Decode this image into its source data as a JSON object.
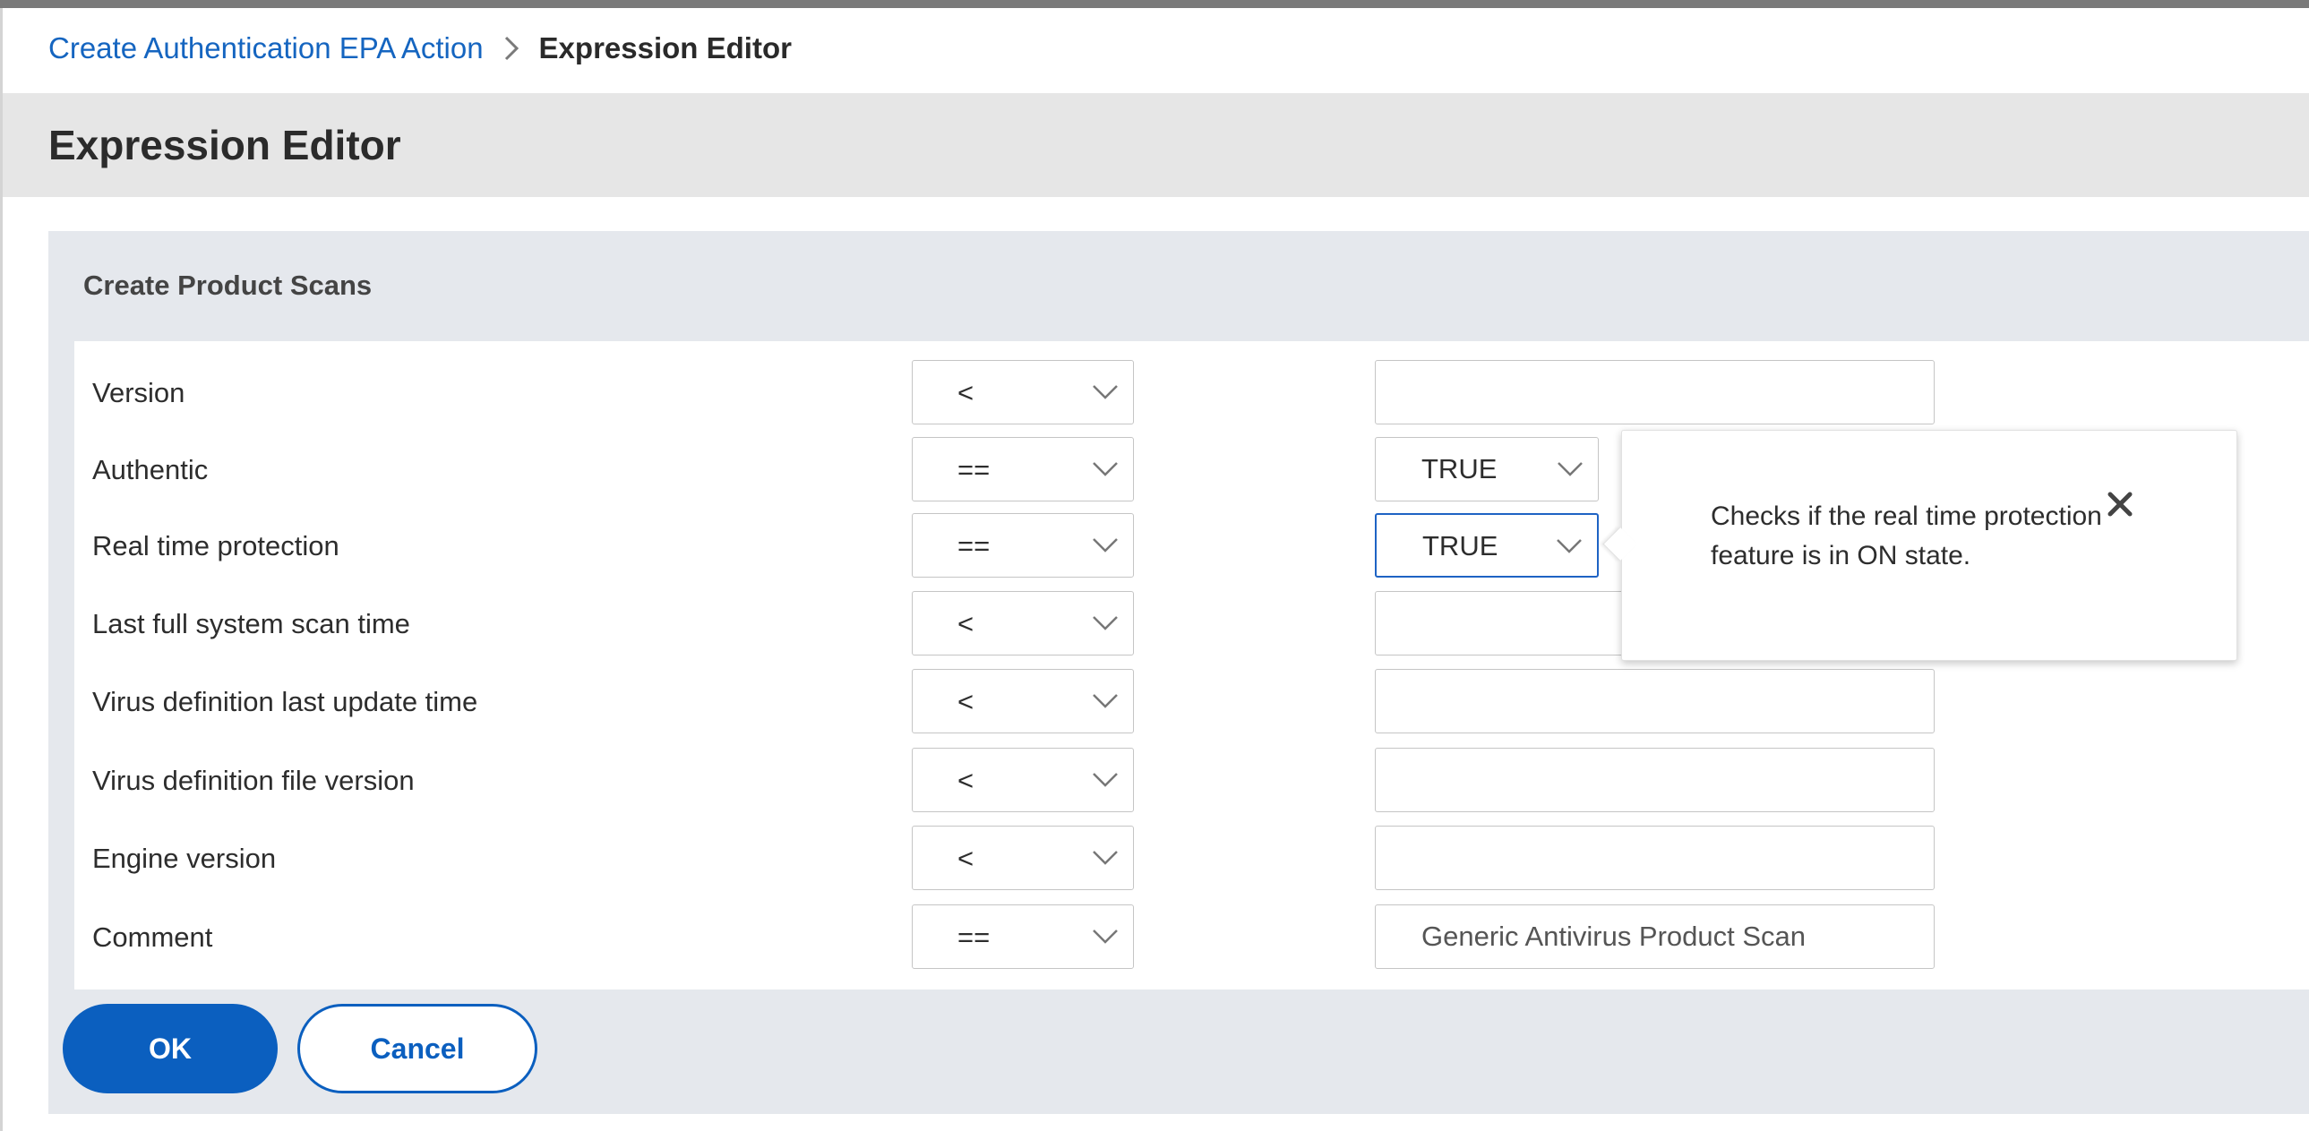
{
  "breadcrumb": {
    "parent_label": "Create Authentication EPA Action",
    "current_label": "Expression Editor"
  },
  "page": {
    "title": "Expression Editor"
  },
  "panel": {
    "title": "Create Product Scans"
  },
  "rows": [
    {
      "label": "Version",
      "operator": "<",
      "value": "",
      "value_type": "text"
    },
    {
      "label": "Authentic",
      "operator": "==",
      "value": "TRUE",
      "value_type": "select"
    },
    {
      "label": "Real time protection",
      "operator": "==",
      "value": "TRUE",
      "value_type": "select",
      "focused": true
    },
    {
      "label": "Last full system scan time",
      "operator": "<",
      "value": "",
      "value_type": "text"
    },
    {
      "label": "Virus definition last update time",
      "operator": "<",
      "value": "",
      "value_type": "text"
    },
    {
      "label": "Virus definition file version",
      "operator": "<",
      "value": "",
      "value_type": "text"
    },
    {
      "label": "Engine version",
      "operator": "<",
      "value": "",
      "value_type": "text"
    },
    {
      "label": "Comment",
      "operator": "==",
      "value": "Generic Antivirus Product Scan",
      "value_type": "text"
    }
  ],
  "tooltip": {
    "text": "Checks if the real time protection feature is in ON state.",
    "close_icon": "close-icon"
  },
  "actions": {
    "ok_label": "OK",
    "cancel_label": "Cancel"
  },
  "colors": {
    "link": "#1565c0",
    "primary": "#0b5fbf",
    "focus": "#1e63c4",
    "header_bg": "#e6e6e6",
    "panel_bg": "#e5e8ed"
  },
  "icons": {
    "breadcrumb_separator": "chevron-right-icon",
    "dropdown": "chevron-down-icon"
  }
}
